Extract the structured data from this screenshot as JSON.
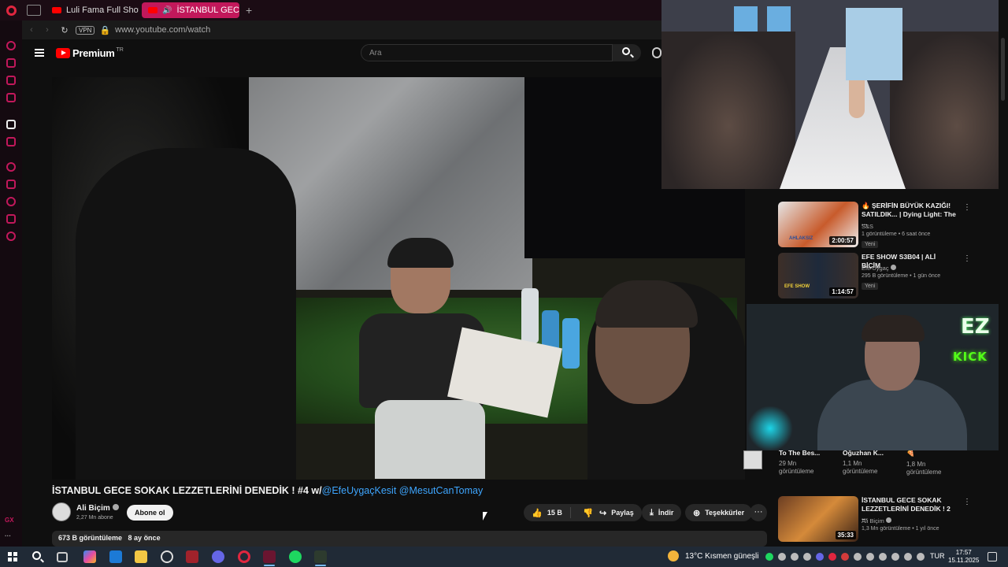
{
  "browser": {
    "tabs": [
      {
        "label": "Luli Fama Full Show in SLO"
      },
      {
        "label": "İSTANBUL GECE SOKA"
      }
    ],
    "new_tab": "+",
    "url": "www.youtube.com/watch",
    "vpn": "VPN",
    "sidebar_badge": "GX",
    "sidebar_more": "···"
  },
  "youtube": {
    "logo": "Premium",
    "country": "TR",
    "search_placeholder": "Ara"
  },
  "video": {
    "title": "İSTANBUL GECE SOKAK LEZZETLERİNİ DENEDİK ! #4 w/",
    "mentions": "@EfeUygaçKesit @MesutCanTomay",
    "channel_name": "Ali Biçim",
    "subscribers": "2,27 Mn abone",
    "subscribe": "Abone ol",
    "likes": "15 B",
    "share": "Paylaş",
    "download": "İndir",
    "thanks": "Teşekkürler",
    "more": "···",
    "views": "673 B görüntüleme",
    "age": "8 ay önce"
  },
  "suggestions": [
    {
      "title": "🔥 ŞERİFİN BÜYÜK KAZIĞI! SATILDIK... | Dying Light: The ...",
      "channel": "S&S",
      "stats": "1 görüntüleme • 6 saat önce",
      "badge": "Yeni",
      "duration": "2:00:57",
      "thumb_text": "AHLAKSIZ"
    },
    {
      "title": "EFE SHOW S3B04 | ALİ BİÇİM",
      "channel": "Efe Uygaç",
      "stats": "295 B görüntüleme • 1 gün önce",
      "badge": "Yeni",
      "duration": "1:14:57",
      "thumb_text": "EFE SHOW"
    },
    {
      "title": "İSTANBUL GECE SOKAK LEZZETLERİNİ DENEDİK ! 2 ...",
      "channel": "Ali Biçim",
      "stats": "1,3 Mn görüntüleme • 1 yıl önce",
      "badge": "",
      "duration": "35:33",
      "thumb_text": ""
    }
  ],
  "shorts": [
    {
      "name": "To The Bes...",
      "views": "29 Mn görüntüleme"
    },
    {
      "name": "Oğuzhan K...",
      "views": "1,1 Mn görüntüleme"
    },
    {
      "name": "🍕",
      "views": "1,8 Mn görüntüleme"
    }
  ],
  "overlay": {
    "ez": "EZ",
    "kick": "KICK"
  },
  "taskbar": {
    "weather": "13°C  Kısmen güneşli",
    "lang": "TUR",
    "time": "17:57",
    "date": "15.11.2025"
  },
  "colors": {
    "opera_red": "#e0263f",
    "active_tab": "#c2185b",
    "youtube_red": "#ff0000",
    "link_blue": "#3ea6ff",
    "kick_green": "#53fc18"
  }
}
